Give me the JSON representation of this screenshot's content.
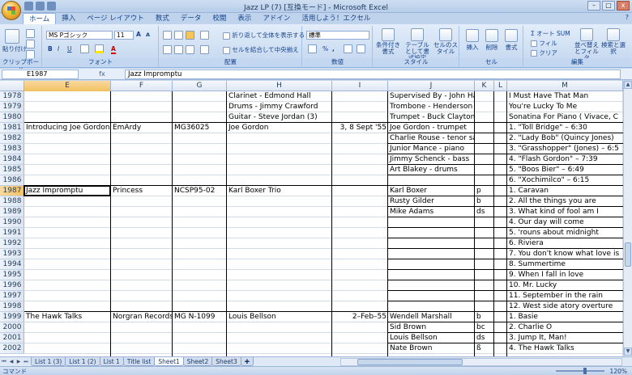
{
  "window": {
    "title": "Jazz LP (7)  [互換モード] - Microsoft Excel",
    "buttons": {
      "minimize": "–",
      "maximize": "□",
      "close": "x"
    }
  },
  "ribbon": {
    "tabs": [
      "ホーム",
      "挿入",
      "ページ レイアウト",
      "数式",
      "データ",
      "校閲",
      "表示",
      "アドイン",
      "活用しよう！エクセル"
    ],
    "active_tab": "ホーム",
    "help": "?",
    "groups": {
      "clipboard": {
        "label": "クリップボード",
        "paste": "貼り付け"
      },
      "font": {
        "label": "フォント",
        "font_name": "MS Pゴシック",
        "font_size": "11",
        "bold": "B",
        "italic": "I",
        "underline": "U",
        "grow": "A",
        "shrink": "A",
        "font_color": "A"
      },
      "alignment": {
        "label": "配置",
        "wrap": "折り返して全体を表示する",
        "merge": "セルを結合して中央揃え"
      },
      "number": {
        "label": "数値",
        "format": "標準",
        "percent": "%",
        "comma": ","
      },
      "styles": {
        "label": "スタイル",
        "conditional": "条件付き書式",
        "table": "テーブルとして書式設定",
        "cell_styles": "セルのスタイル"
      },
      "cells": {
        "label": "セル",
        "insert": "挿入",
        "delete": "削除",
        "format": "書式"
      },
      "editing": {
        "label": "編集",
        "autosum": "Σ オート SUM",
        "fill": "フィル",
        "clear": "クリア",
        "sort": "並べ替えとフィルタ",
        "find": "検索と選択"
      }
    }
  },
  "formula_bar": {
    "name_box": "E1987",
    "fx": "fx",
    "formula": "Jazz Impromptu"
  },
  "grid": {
    "columns": [
      "E",
      "F",
      "G",
      "H",
      "I",
      "J",
      "K",
      "L",
      "M"
    ],
    "selected_column": "E",
    "rows": [
      "1978",
      "1979",
      "1980",
      "1981",
      "1982",
      "1983",
      "1984",
      "1985",
      "1986",
      "1987",
      "1988",
      "1989",
      "1990",
      "1991",
      "1992",
      "1993",
      "1994",
      "1995",
      "1996",
      "1997",
      "1998",
      "1999",
      "2000",
      "2001",
      "2002"
    ],
    "selected_row": "1987",
    "cells": {
      "H1978": "Clarinet - Edmond Hall",
      "J1978": "Supervised By - John Hammond",
      "M1978": "I Must Have That Man",
      "H1979": "Drums - Jimmy Crawford",
      "J1979": "Trombone - Henderson Chambers",
      "M1979": "You're Lucky To Me",
      "H1980": "Guitar - Steve Jordan (3)",
      "J1980": "Trumpet - Buck Clayton",
      "M1980": "Sonatina For Piano ( Vivace, C",
      "E1981": "Introducing Joe Gordon",
      "F1981": "EmArdy",
      "G1981": "MG36025",
      "H1981": "Joe Gordon",
      "I1981": "3, 8 Sept '55",
      "J1981": "Joe Gordon - trumpet",
      "M1981": "1. \"Toll Bridge\" – 6:30",
      "J1982": "Charlie Rouse - tenor saxophone",
      "M1982": "2. \"Lady Bob\" (Quincy Jones)",
      "J1983": "Junior Mance - piano",
      "M1983": "3. \"Grasshopper\" (Jones) – 6:5",
      "J1984": "Jimmy Schenck - bass",
      "M1984": "4. \"Flash Gordon\" – 7:39",
      "J1985": "Art Blakey - drums",
      "M1985": "5. \"Boos Bier\" – 6:49",
      "M1986": "6. \"Xochimilco\" – 6:15",
      "E1987": "Jazz Impromptu",
      "F1987": "Princess",
      "G1987": "NCSP95-02",
      "H1987": "Karl Boxer Trio",
      "J1987": "Karl Boxer",
      "K1987": "p",
      "M1987": "1. Caravan",
      "J1988": "Rusty Gilder",
      "K1988": "b",
      "M1988": "2. All the things you are",
      "J1989": "Mike Adams",
      "K1989": "ds",
      "M1989": "3. What kind of fool am I",
      "M1990": "4. Our day will come",
      "M1991": "5. 'rouns about midnight",
      "M1992": "6. Riviera",
      "M1993": "7. You don't know what love is",
      "M1994": "8. Summertime",
      "M1995": "9. When I fall in love",
      "M1996": "10. Mr. Lucky",
      "M1997": "11. September in the rain",
      "M1998": "12. West side atory overture",
      "E1999": "The Hawk Talks",
      "F1999": "Norgran Records",
      "G1999": "MG N-1099",
      "H1999": "Louis Bellson",
      "I1999": "2–Feb–55",
      "J1999": "Wendell Marshall",
      "K1999": "b",
      "M1999": "1. Basie",
      "J2000": "Sid Brown",
      "K2000": "bc",
      "M2000": "2. Charlie O",
      "J2001": "Louis Bellson",
      "K2001": "ds",
      "M2001": "3. Jump It, Man!",
      "J2002": "Nate Brown",
      "K2002": "ß",
      "M2002": "4. The Hawk Talks"
    }
  },
  "sheet_tabs": [
    "List 1 (3)",
    "List 1 (2)",
    "List 1",
    "Title list",
    "Sheet1",
    "Sheet2",
    "Sheet3"
  ],
  "active_sheet": "Sheet1",
  "status": {
    "mode": "コマンド",
    "zoom": "120%"
  }
}
